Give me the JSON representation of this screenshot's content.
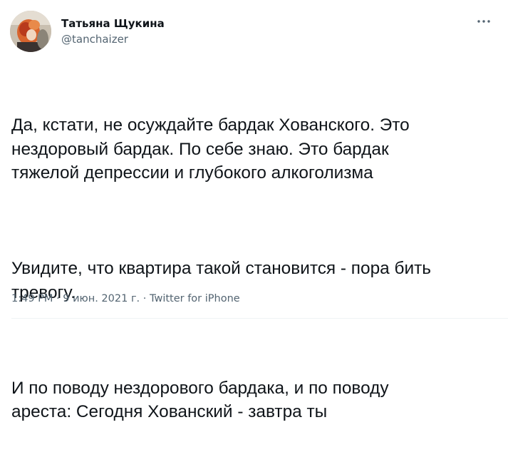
{
  "author": {
    "display_name": "Татьяна Щукина",
    "handle": "@tanchaizer",
    "avatar_icon": "profile-photo"
  },
  "menu": {
    "icon": "more-horizontal-icon"
  },
  "tweet": {
    "paragraphs": [
      "Да, кстати, не осуждайте бардак Хованского. Это\nнездоровый бардак. По себе знаю. Это бардак\nтяжелой депрессии и глубокого алкоголизма",
      "Увидите, что квартира такой становится - пора бить\nтревогу.",
      "И по поводу нездорового бардака, и по поводу\nареста: Сегодня Хованский - завтра ты"
    ]
  },
  "meta": {
    "time": "1:49 PM",
    "separator": " · ",
    "date": "9 июн. 2021 г.",
    "source": "Twitter for iPhone"
  },
  "colors": {
    "text": "#0f1419",
    "secondary": "#536471",
    "background": "#ffffff"
  }
}
